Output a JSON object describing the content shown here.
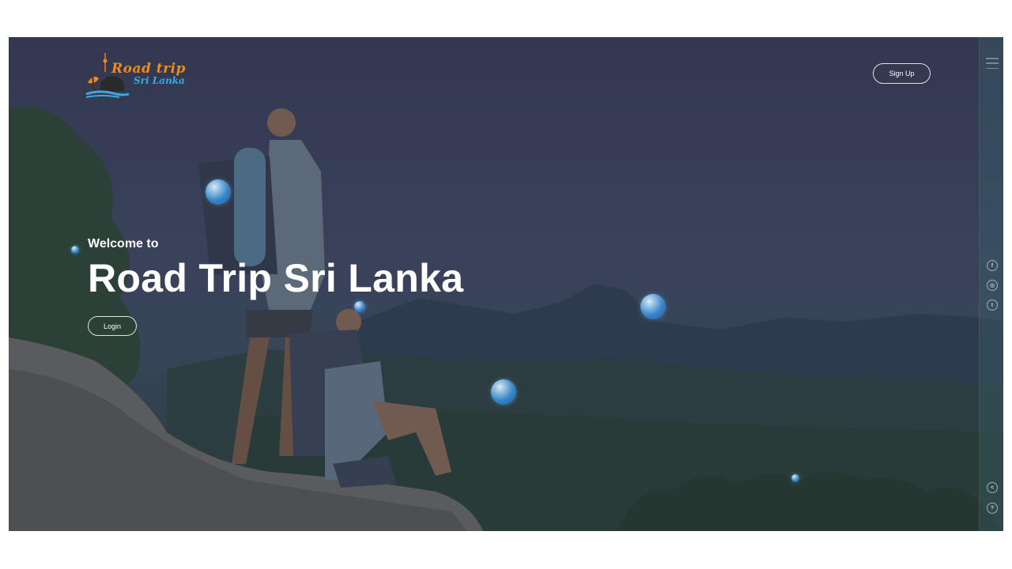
{
  "brand": {
    "line1": "Road trip",
    "line2": "Sri Lanka",
    "orange": "#f08a1c",
    "blue": "#3da8e0"
  },
  "header": {
    "signup_label": "Sign Up"
  },
  "hero": {
    "welcome": "Welcome to",
    "title": "Road Trip Sri Lanka",
    "login_label": "Login"
  },
  "rail": {
    "menu_icon": "hamburger-icon",
    "social": [
      {
        "name": "facebook",
        "glyph": "f"
      },
      {
        "name": "instagram",
        "glyph": "◎"
      },
      {
        "name": "twitter",
        "glyph": "t"
      }
    ],
    "bottom": [
      {
        "name": "share",
        "glyph": "<"
      },
      {
        "name": "help",
        "glyph": "?"
      }
    ]
  }
}
